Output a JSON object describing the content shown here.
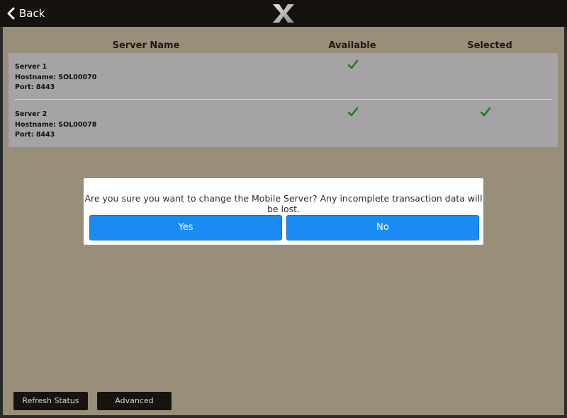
{
  "topbar": {
    "back_label": "Back",
    "logo": "x-logo-icon"
  },
  "table": {
    "headers": {
      "name": "Server Name",
      "available": "Available",
      "selected": "Selected"
    },
    "rows": [
      {
        "name": "Server 1",
        "hostname": "Hostname: SOL00070",
        "port": "Port: 8443",
        "available": true,
        "selected": false
      },
      {
        "name": "Server 2",
        "hostname": "Hostname: SOL00078",
        "port": "Port: 8443",
        "available": true,
        "selected": true
      }
    ]
  },
  "dialog": {
    "message": "Are you sure you want to change the Mobile Server? Any incomplete transaction data will be lost.",
    "yes_label": "Yes",
    "no_label": "No"
  },
  "footer": {
    "refresh_label": "Refresh Status",
    "advanced_label": "Advanced"
  },
  "colors": {
    "background": "#998e79",
    "topbar": "#15120f",
    "table": "#a5a3a6",
    "button": "#1a8bf3",
    "check": "#1f7a1f"
  }
}
